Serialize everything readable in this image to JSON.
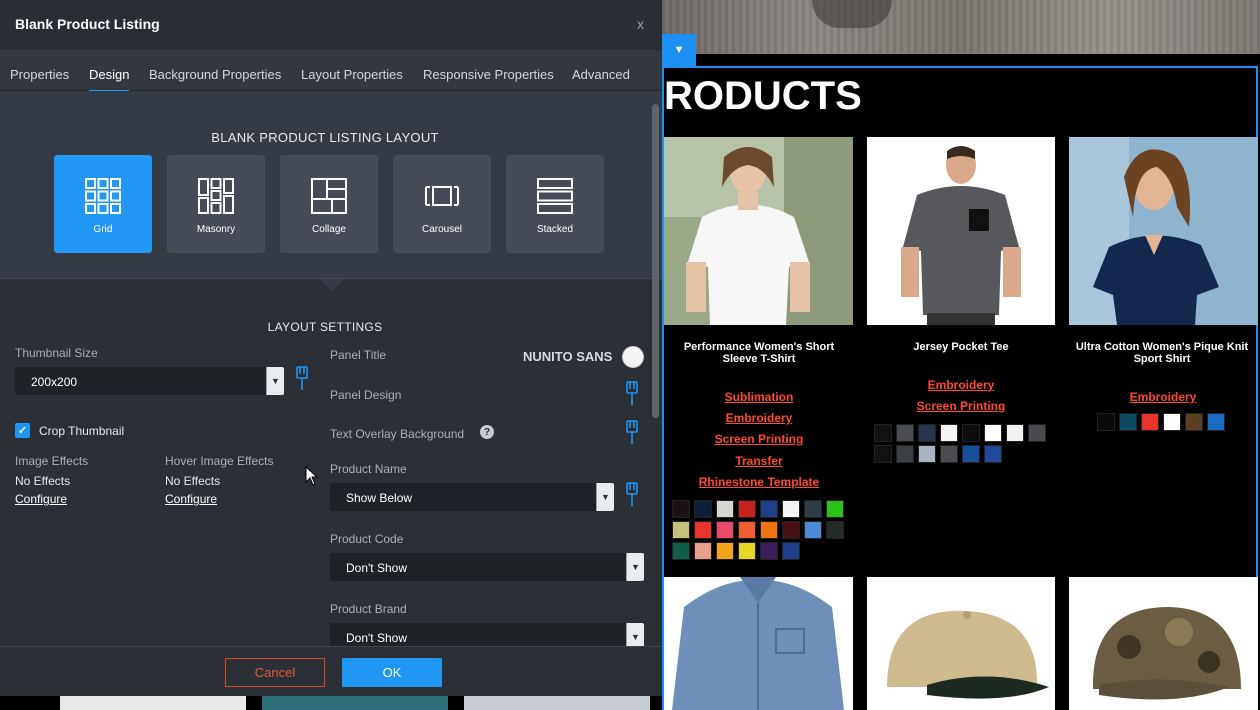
{
  "modal": {
    "title": "Blank Product Listing",
    "close": "x",
    "tabs": [
      {
        "label": "Properties"
      },
      {
        "label": "Design"
      },
      {
        "label": "Background Properties"
      },
      {
        "label": "Layout Properties"
      },
      {
        "label": "Responsive Properties"
      },
      {
        "label": "Advanced"
      }
    ],
    "active_tab": "Design",
    "layout_heading": "BLANK PRODUCT LISTING LAYOUT",
    "layouts": [
      {
        "label": "Grid",
        "icon": "grid-icon",
        "selected": true
      },
      {
        "label": "Masonry",
        "icon": "masonry-icon",
        "selected": false
      },
      {
        "label": "Collage",
        "icon": "collage-icon",
        "selected": false
      },
      {
        "label": "Carousel",
        "icon": "carousel-icon",
        "selected": false
      },
      {
        "label": "Stacked",
        "icon": "stacked-icon",
        "selected": false
      }
    ],
    "settings_heading": "LAYOUT SETTINGS",
    "thumbnail_size": {
      "label": "Thumbnail Size",
      "value": "200x200"
    },
    "crop_thumbnail": {
      "label": "Crop Thumbnail",
      "checked": true
    },
    "image_effects": {
      "label": "Image Effects",
      "value": "No Effects",
      "link": "Configure"
    },
    "hover_image_effects": {
      "label": "Hover Image Effects",
      "value": "No Effects",
      "link": "Configure"
    },
    "panel_title": {
      "label": "Panel Title",
      "font": "NUNITO SANS",
      "color": "#f4f4f4"
    },
    "panel_design": {
      "label": "Panel Design"
    },
    "text_overlay_background": {
      "label": "Text Overlay Background",
      "help": "?"
    },
    "product_name": {
      "label": "Product Name",
      "value": "Show Below"
    },
    "product_code": {
      "label": "Product Code",
      "value": "Don't Show"
    },
    "product_brand": {
      "label": "Product Brand",
      "value": "Don't Show"
    },
    "cancel_label": "Cancel",
    "ok_label": "OK",
    "accent": "#2196f3",
    "danger": "#d2492a"
  },
  "preview": {
    "section_title": "RODUCTS",
    "products": [
      {
        "name": "Performance Women's Short Sleeve T-Shirt",
        "services": [
          "Sublimation",
          "Embroidery",
          "Screen Printing",
          "Transfer",
          "Rhinestone Template"
        ],
        "swatches": [
          "#1a1213",
          "#0f1f3a",
          "#d8d6d0",
          "#c8221f",
          "#1d3f8c",
          "#f4f4f4",
          "#2f3b47",
          "#2cc21c",
          "#c7c07a",
          "#e8352b",
          "#e84a6b",
          "#ee5d34",
          "#f07412",
          "#4a1114",
          "#4d8bd6",
          "#232c2a",
          "#0e5e4a",
          "#e7a08a",
          "#f3a21b",
          "#e6d625",
          "#3a1d5c",
          "#1c3f8c"
        ]
      },
      {
        "name": "Jersey Pocket Tee",
        "services": [
          "Embroidery",
          "Screen Printing"
        ],
        "swatches": [
          "#111111",
          "#4a4d52",
          "#27344d",
          "#f4f4f4",
          "#0d0d0d",
          "#ffffff",
          "#f0f0f0",
          "#4b4b4f",
          "#111111",
          "#3b3f44",
          "#a9b4c2",
          "#4b4b50",
          "#1a4f9e",
          "#1f4a99"
        ]
      },
      {
        "name": "Ultra Cotton Women's Pique Knit Sport Shirt",
        "services": [
          "Embroidery"
        ],
        "swatches": [
          "#0a0a0a",
          "#0f4a63",
          "#e8352b",
          "#ffffff",
          "#5b4020",
          "#1a6cc4"
        ]
      }
    ],
    "accent": "#1e8ff4",
    "service_color": "#ff4a2f"
  }
}
